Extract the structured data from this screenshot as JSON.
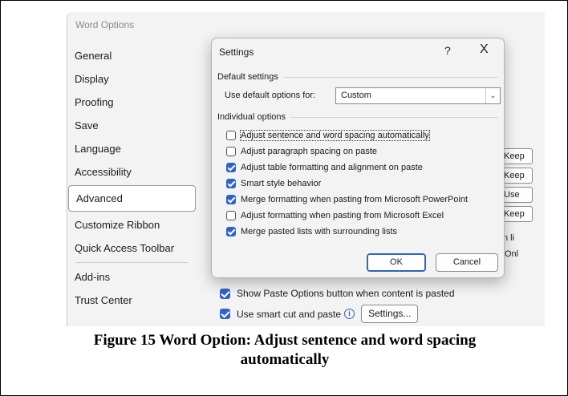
{
  "options_window": {
    "title": "Word Options",
    "nav": [
      {
        "label": "General"
      },
      {
        "label": "Display"
      },
      {
        "label": "Proofing"
      },
      {
        "label": "Save"
      },
      {
        "label": "Language"
      },
      {
        "label": "Accessibility"
      },
      {
        "label": "Advanced",
        "active": true
      },
      {
        "label": "Customize Ribbon"
      },
      {
        "label": "Quick Access Toolbar"
      },
      {
        "label": "Add-ins"
      },
      {
        "label": "Trust Center"
      }
    ],
    "side_buttons": [
      "Keep",
      "Keep",
      "Use",
      "Keep"
    ],
    "side_texts": [
      "n li",
      "Onl"
    ],
    "options": [
      {
        "label": "Show Paste Options button when content is pasted",
        "checked": true
      },
      {
        "label": "Use smart cut and paste",
        "checked": true,
        "button": "Settings..."
      }
    ]
  },
  "dialog": {
    "title": "Settings",
    "help_label": "?",
    "close_label": "X",
    "default_section": "Default settings",
    "default_label": "Use default options for:",
    "default_value": "Custom",
    "individual_section": "Individual options",
    "options": [
      {
        "label": "Adjust sentence and word spacing automatically",
        "checked": false
      },
      {
        "label": "Adjust paragraph spacing on paste",
        "checked": false
      },
      {
        "label": "Adjust table formatting and alignment on paste",
        "checked": true
      },
      {
        "label": "Smart style behavior",
        "checked": true
      },
      {
        "label": "Merge formatting when pasting from Microsoft PowerPoint",
        "checked": true
      },
      {
        "label": "Adjust formatting when pasting from Microsoft Excel",
        "checked": false
      },
      {
        "label": "Merge pasted lists with surrounding lists",
        "checked": true
      }
    ],
    "ok_label": "OK",
    "cancel_label": "Cancel"
  },
  "caption": {
    "line1": "Figure 15 Word Option: Adjust sentence and word spacing",
    "line2": "automatically"
  },
  "colors": {
    "accent": "#2f63c7",
    "window_bg": "#f3f3f3"
  }
}
